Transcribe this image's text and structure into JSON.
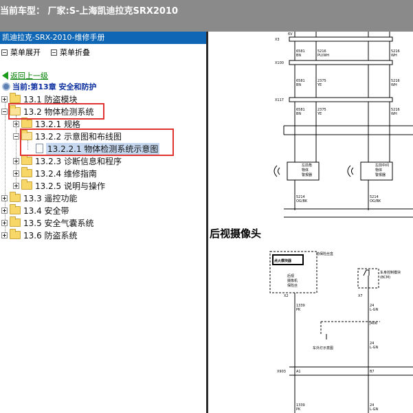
{
  "window": {
    "title": "当前车型： 厂家:S-上海凯迪拉克SRX2010"
  },
  "left_panel": {
    "header": "凯迪拉克-SRX-2010-维修手册",
    "expand_menu": "菜单展开",
    "collapse_menu": "菜单折叠",
    "back_link": "返回上一级",
    "current_chapter": "当前:第13章 安全和防护",
    "tree": [
      {
        "id": "n1",
        "label": "13.1 防盗模块",
        "expander": "plus",
        "folder": "closed"
      },
      {
        "id": "n2",
        "label": "13.2 物体检测系统",
        "expander": "minus",
        "folder": "open"
      },
      {
        "id": "n3",
        "label": "13.2.1 规格",
        "expander": "plus",
        "folder": "closed"
      },
      {
        "id": "n4",
        "label": "13.2.2 示意图和布线图",
        "expander": "minus",
        "folder": "open"
      },
      {
        "id": "n5",
        "label": "13.2.2.1 物体检测系统示意图",
        "expander": "none",
        "folder": "doc",
        "selected": true
      },
      {
        "id": "n6",
        "label": "13.2.3 诊断信息和程序",
        "expander": "plus",
        "folder": "closed"
      },
      {
        "id": "n7",
        "label": "13.2.4 维修指南",
        "expander": "plus",
        "folder": "closed"
      },
      {
        "id": "n8",
        "label": "13.2.5 说明与操作",
        "expander": "plus",
        "folder": "closed"
      },
      {
        "id": "n9",
        "label": "13.3 遥控功能",
        "expander": "plus",
        "folder": "closed"
      },
      {
        "id": "n10",
        "label": "13.4 安全带",
        "expander": "plus",
        "folder": "closed"
      },
      {
        "id": "n11",
        "label": "13.5 安全气囊系统",
        "expander": "plus",
        "folder": "closed"
      },
      {
        "id": "n12",
        "label": "13.6 防盗系统",
        "expander": "plus",
        "folder": "closed"
      }
    ]
  },
  "diagram": {
    "section_title": "后视摄像头",
    "sensor_left_label": "左前角物体警报器传感器",
    "sensor_right_label": "左前中间物体警报器传感器",
    "connector_labels": [
      "X3",
      "X100",
      "X117",
      "X2",
      "X7",
      "J406",
      "X903"
    ],
    "pin_labels": [
      "6V",
      "5",
      "29",
      "30",
      "31",
      "F",
      "D",
      "E",
      "1",
      "2",
      "16",
      "A1",
      "B7"
    ],
    "wire_labels": [
      "6581 BN",
      "5216 PU/WH",
      "2375 YE",
      "5216 WH",
      "5214 OG/BK",
      "1339 PK",
      "24 L-GN"
    ],
    "fuse_box_label": "前保险丝盒",
    "fuse_label_a": "点火模块器",
    "fuse_label_b": "后视摄像机保险丝 10安",
    "module_label": "车身控制模块 (BCM)",
    "ground_label": "车外灯示意图"
  },
  "colors": {
    "title_bar": "#8a8a8a",
    "pane_header": "#0e66b4",
    "highlight_box": "#e0322e",
    "selection": "#c6d8ef",
    "folder": "#f6d768",
    "splitter": "#2b2b2b"
  }
}
